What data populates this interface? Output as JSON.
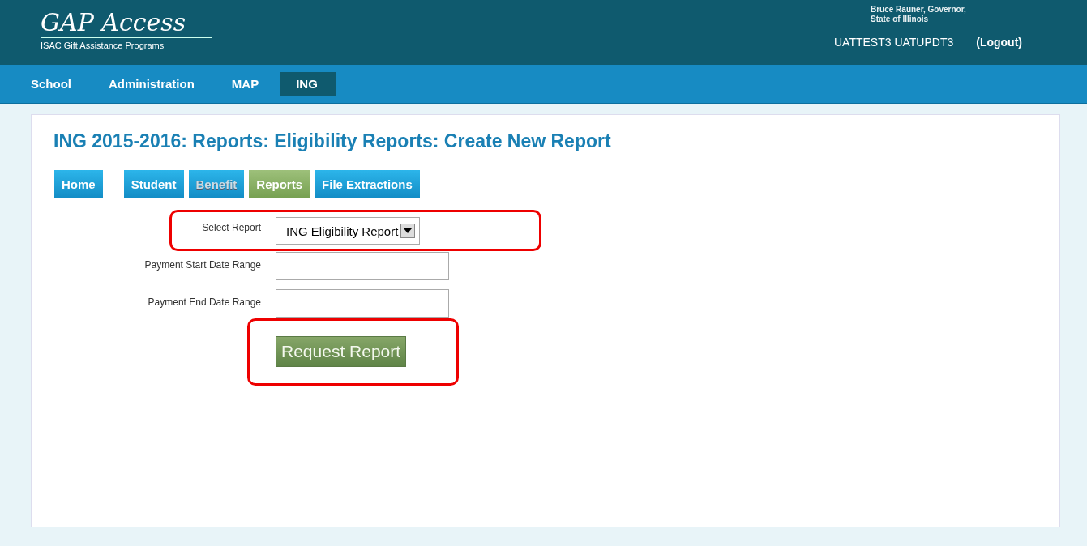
{
  "header": {
    "logo_title": "GAP Access",
    "logo_subtitle": "ISAC Gift Assistance Programs",
    "governor_line1": "Bruce Rauner, Governor,",
    "governor_line2": "State of Illinois",
    "user": "UATTEST3 UATUPDT3",
    "logout": "(Logout)"
  },
  "nav": [
    {
      "label": "School",
      "selected": false
    },
    {
      "label": "Administration",
      "selected": false
    },
    {
      "label": "MAP",
      "selected": false
    },
    {
      "label": "ING",
      "selected": true
    }
  ],
  "page_title": "ING 2015-2016: Reports: Eligibility Reports: Create New Report",
  "tabs": [
    {
      "label": "Home",
      "selected": false,
      "disabled": false
    },
    {
      "label": "Student",
      "selected": false,
      "disabled": false
    },
    {
      "label": "Benefit",
      "selected": false,
      "disabled": true
    },
    {
      "label": "Reports",
      "selected": true,
      "disabled": false
    },
    {
      "label": "File Extractions",
      "selected": false,
      "disabled": false
    }
  ],
  "form": {
    "fields": [
      {
        "kind": "select",
        "label": "Select Report",
        "value": "ING Eligibility Report",
        "highlighted": true
      },
      {
        "kind": "text",
        "label": "Payment Start Date Range",
        "highlighted": false
      },
      {
        "kind": "text",
        "label": "Payment End Date Range",
        "highlighted": false
      }
    ],
    "submit": {
      "label": "Request Report",
      "highlighted": true
    }
  }
}
